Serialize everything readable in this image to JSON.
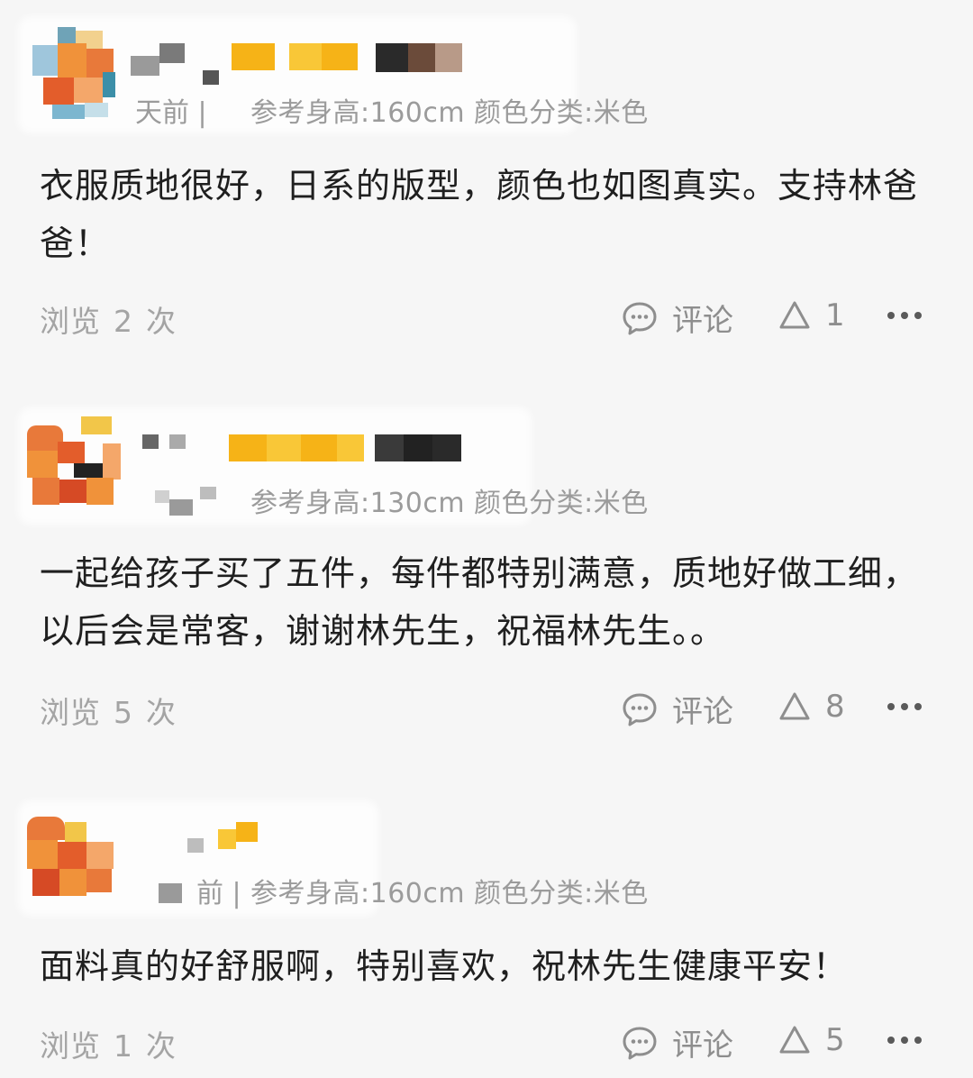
{
  "reviews": [
    {
      "meta_prefix": "天前",
      "meta": "参考身高:160cm 颜色分类:米色",
      "separator": "|",
      "content": "衣服质地很好，日系的版型，颜色也如图真实。支持林爸爸！",
      "views_label": "浏览",
      "views_count": "2",
      "views_unit": "次",
      "comment_label": "评论",
      "like_count": "1"
    },
    {
      "meta_prefix": "",
      "meta": "参考身高:130cm 颜色分类:米色",
      "separator": "",
      "content": "一起给孩子买了五件，每件都特别满意，质地好做工细，以后会是常客，谢谢林先生，祝福林先生。。",
      "views_label": "浏览",
      "views_count": "5",
      "views_unit": "次",
      "comment_label": "评论",
      "like_count": "8"
    },
    {
      "meta_prefix": "前",
      "meta": "参考身高:160cm 颜色分类:米色",
      "separator": "|",
      "content": "面料真的好舒服啊，特别喜欢，祝林先生健康平安！",
      "views_label": "浏览",
      "views_count": "1",
      "views_unit": "次",
      "comment_label": "评论",
      "like_count": "5"
    }
  ],
  "icons": {
    "comment": "comment-bubble-icon",
    "like": "triangle-like-icon",
    "more": "more-dots-icon"
  },
  "colors": {
    "background": "#f6f6f6",
    "text": "#1f1f1f",
    "meta": "#9b9b9b",
    "muted": "#a4a4a4",
    "icon": "#8e8e8e"
  }
}
